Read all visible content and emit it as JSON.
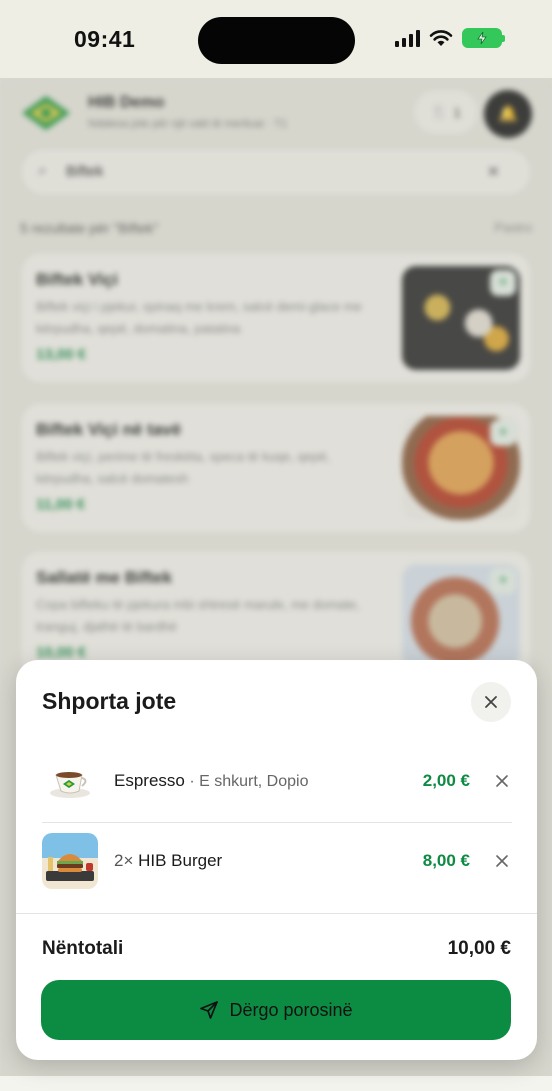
{
  "status_bar": {
    "time": "09:41",
    "icons": [
      "signal-icon",
      "wifi-icon",
      "battery-charging-icon"
    ]
  },
  "background": {
    "restaurant_name": "HIB Demo",
    "restaurant_subtitle": "Ndalesa jote për një vakt të merituar · T1",
    "table_count": "1",
    "search_value": "Biftek",
    "results_text": "5 rezultate për \"Biftek\"",
    "clear_filter": "Pastro",
    "menu_items": [
      {
        "name": "Biftek Viçi",
        "desc": "Biftek viçi i pjekur, spinaq me krem, salcë demi-glace me kërpudha, qepë, domatina, patatina",
        "price": "13,00 €"
      },
      {
        "name": "Biftek Viçi në tavë",
        "desc": "Biftek viçi, perime të freskëta, speca të kuqe, qepë, kërpudha, salcë domatesh",
        "price": "11,00 €"
      },
      {
        "name": "Sallatë me Biftek",
        "desc": "Copa bifteku të pjekura mbi shtresë marule, me domate, tranguj, djathë të bardhë",
        "price": "10,00 €"
      }
    ]
  },
  "cart": {
    "title": "Shporta jote",
    "items": [
      {
        "qty": "",
        "name": "Espresso",
        "options": " · E shkurt, Dopio",
        "price": "2,00 €",
        "icon": "espresso-cup"
      },
      {
        "qty": "2× ",
        "name": "HIB Burger",
        "options": "",
        "price": "8,00 €",
        "icon": "burger"
      }
    ],
    "subtotal_label": "Nëntotali",
    "subtotal_value": "10,00 €",
    "send_label": "Dërgo porosinë"
  },
  "colors": {
    "accent": "#0c8c43",
    "price_green": "#0f8a43",
    "background": "#eeeee4"
  }
}
